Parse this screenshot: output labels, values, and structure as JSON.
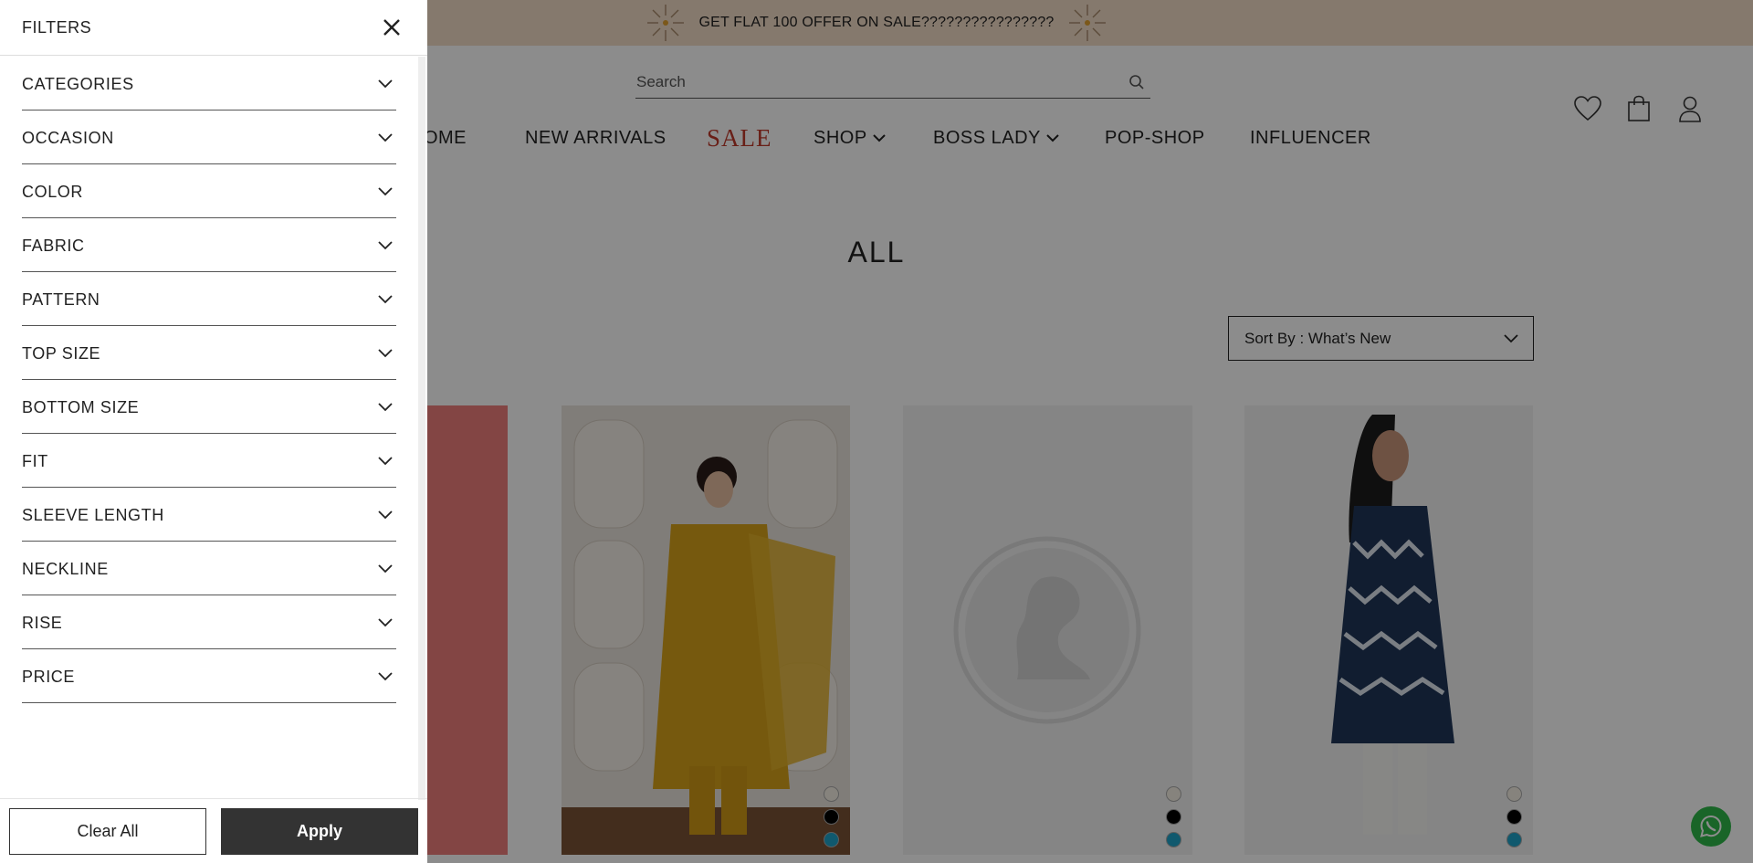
{
  "announcement": {
    "text": "GET FLAT 100 OFFER ON SALE????????????????"
  },
  "search": {
    "placeholder": "Search"
  },
  "nav": {
    "items": [
      {
        "label": "HOME"
      },
      {
        "label": "NEW ARRIVALS"
      },
      {
        "label": "SALE"
      },
      {
        "label": "SHOP"
      },
      {
        "label": "BOSS LADY"
      },
      {
        "label": "POP-SHOP"
      },
      {
        "label": "INFLUENCER"
      }
    ]
  },
  "page": {
    "title": "ALL"
  },
  "sort": {
    "label": "Sort By : What’s New"
  },
  "filters": {
    "title": "FILTERS",
    "items": [
      {
        "label": "CATEGORIES"
      },
      {
        "label": "OCCASION"
      },
      {
        "label": "COLOR"
      },
      {
        "label": "FABRIC"
      },
      {
        "label": "PATTERN"
      },
      {
        "label": "TOP SIZE"
      },
      {
        "label": "BOTTOM SIZE"
      },
      {
        "label": "FIT"
      },
      {
        "label": "SLEEVE LENGTH"
      },
      {
        "label": "NECKLINE"
      },
      {
        "label": "RISE"
      },
      {
        "label": "PRICE"
      }
    ],
    "clear_label": "Clear All",
    "apply_label": "Apply"
  },
  "products": {
    "swatch_colors": [
      "#f4efe3",
      "#000000",
      "#1ea3c9"
    ]
  },
  "colors": {
    "announcement_bg": "#f3dcc6",
    "sale": "#c0392b",
    "apply_bg": "#333333",
    "whatsapp": "#2fb84a"
  },
  "icons": {
    "announcement": "sparkle-burst-icon",
    "search": "search-icon",
    "wishlist": "heart-icon",
    "cart": "shopping-bag-icon",
    "account": "user-icon",
    "close": "close-icon",
    "expand": "chevron-down-icon",
    "chat": "whatsapp-icon"
  }
}
